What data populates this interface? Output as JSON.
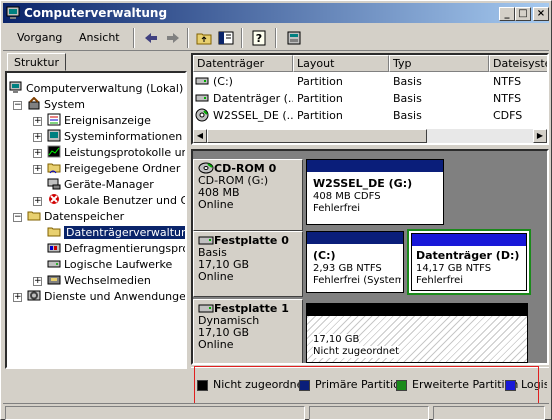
{
  "window": {
    "title": "Computerverwaltung",
    "minimize_glyph": "_",
    "maximize_glyph": "□",
    "close_glyph": "×"
  },
  "toolbar": {
    "action_label": "Vorgang",
    "view_label": "Ansicht"
  },
  "tree": {
    "tab_label": "Struktur",
    "items": [
      {
        "label": "Computerverwaltung (Lokal)",
        "icon": "computer-management-icon"
      },
      {
        "label": "System",
        "icon": "tools-icon"
      },
      {
        "label": "Ereignisanzeige",
        "icon": "event-viewer-icon"
      },
      {
        "label": "Systeminformationen",
        "icon": "system-info-icon"
      },
      {
        "label": "Leistungsprotokolle und W",
        "icon": "performance-icon"
      },
      {
        "label": "Freigegebene Ordner",
        "icon": "shared-folder-icon"
      },
      {
        "label": "Geräte-Manager",
        "icon": "device-manager-icon"
      },
      {
        "label": "Lokale Benutzer und Grup",
        "icon": "users-icon"
      },
      {
        "label": "Datenspeicher",
        "icon": "storage-icon"
      },
      {
        "label": "Datenträgerverwaltung",
        "icon": "disk-management-icon"
      },
      {
        "label": "Defragmentierungsprogr",
        "icon": "defrag-icon"
      },
      {
        "label": "Logische Laufwerke",
        "icon": "logical-drives-icon"
      },
      {
        "label": "Wechselmedien",
        "icon": "removable-media-icon"
      },
      {
        "label": "Dienste und Anwendungen",
        "icon": "services-icon"
      }
    ],
    "expander_plus": "+",
    "expander_minus": "−"
  },
  "list": {
    "columns": [
      "Datenträger",
      "Layout",
      "Typ",
      "Dateisystem"
    ],
    "rows": [
      {
        "name": "(C:)",
        "layout": "Partition",
        "type": "Basis",
        "fs": "NTFS"
      },
      {
        "name": "Datenträger (...",
        "layout": "Partition",
        "type": "Basis",
        "fs": "NTFS"
      },
      {
        "name": "W2SSEL_DE (...",
        "layout": "Partition",
        "type": "Basis",
        "fs": "CDFS"
      }
    ]
  },
  "disks": [
    {
      "title": "CD-ROM 0",
      "line1": "CD-ROM (G:)",
      "line2": "408 MB",
      "line3": "Online",
      "volumes": [
        {
          "name": "W2SSEL_DE  (G:)",
          "size": "408 MB CDFS",
          "status": "Fehlerfrei",
          "color": "#0a1e7a"
        }
      ]
    },
    {
      "title": "Festplatte 0",
      "line1": "Basis",
      "line2": "17,10 GB",
      "line3": "Online",
      "volumes": [
        {
          "name": "(C:)",
          "size": "2,93 GB NTFS",
          "status": "Fehlerfrei (System",
          "color": "#0a1e7a"
        },
        {
          "name": "Datenträger  (D:)",
          "size": "14,17 GB NTFS",
          "status": "Fehlerfrei",
          "color": "#1818d8"
        }
      ]
    },
    {
      "title": "Festplatte 1",
      "line1": "Dynamisch",
      "line2": "17,10 GB",
      "line3": "Online",
      "volumes": [
        {
          "name": "",
          "size": "17,10 GB",
          "status": "Nicht zugeordnet",
          "color": "#000000"
        }
      ]
    }
  ],
  "legend": [
    {
      "label": "Nicht zugeordnet",
      "color": "#000000"
    },
    {
      "label": "Primäre Partition",
      "color": "#0a1e7a"
    },
    {
      "label": "Erweiterte Partition",
      "color": "#1a8a1a"
    },
    {
      "label": "Logis",
      "color": "#1818d8"
    }
  ],
  "colors": {
    "title_start": "#0a246a",
    "title_end": "#a6caf0",
    "selection": "#0a246a",
    "extended_border": "#1a8a1a",
    "highlight_box": "#e02020"
  }
}
